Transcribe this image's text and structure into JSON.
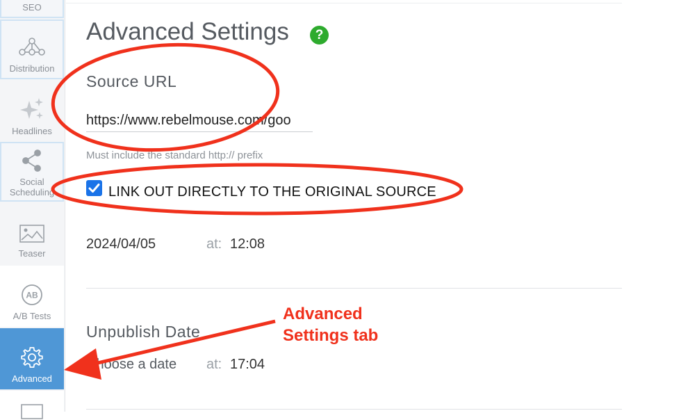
{
  "sidebar": {
    "items": [
      {
        "label": "SEO"
      },
      {
        "label": "Distribution"
      },
      {
        "label": "Headlines"
      },
      {
        "label": "Social Scheduling"
      },
      {
        "label": "Teaser"
      },
      {
        "label": "A/B Tests"
      },
      {
        "label": "Advanced",
        "active": true
      }
    ]
  },
  "page": {
    "title": "Advanced Settings",
    "help_icon": "?"
  },
  "source": {
    "title": "Source URL",
    "url_value": "https://www.rebelmouse.com/goo",
    "hint": "Must include the standard http:// prefix",
    "checkbox_label": "LINK OUT DIRECTLY TO THE ORIGINAL SOURCE",
    "checked": true
  },
  "publish": {
    "date": "2024/04/05",
    "at_label": "at:",
    "time": "12:08"
  },
  "unpublish": {
    "title": "Unpublish Date",
    "date_placeholder": "Choose a date",
    "at_label": "at:",
    "time": "17:04"
  },
  "annotation": {
    "line1": "Advanced",
    "line2": "Settings tab",
    "color": "#f0311c"
  },
  "colors": {
    "active_tab": "#4f97d6",
    "help_icon": "#2eab2e",
    "checkbox": "#1a73e8"
  }
}
